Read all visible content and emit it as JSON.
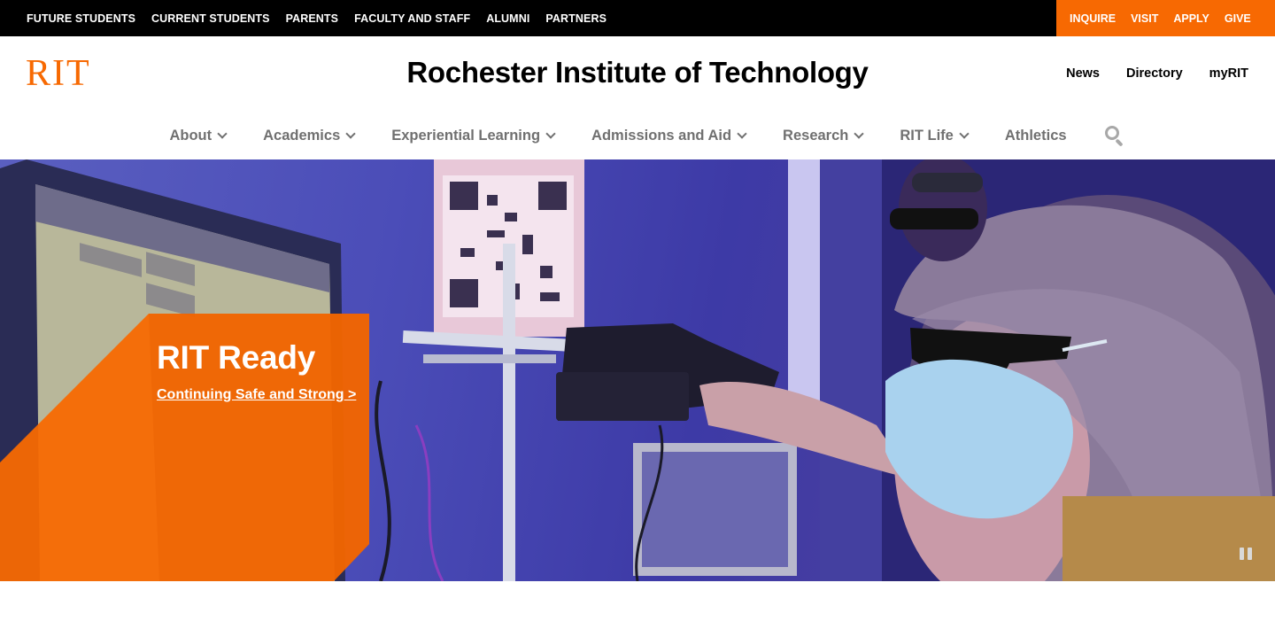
{
  "topbar": {
    "audience_links": [
      "FUTURE STUDENTS",
      "CURRENT STUDENTS",
      "PARENTS",
      "FACULTY AND STAFF",
      "ALUMNI",
      "PARTNERS"
    ],
    "action_links": [
      "INQUIRE",
      "VISIT",
      "APPLY",
      "GIVE"
    ]
  },
  "header": {
    "logo_text": "RIT",
    "title": "Rochester Institute of Technology",
    "utility_links": [
      "News",
      "Directory",
      "myRIT"
    ]
  },
  "nav": {
    "items": [
      {
        "label": "About",
        "has_dropdown": true
      },
      {
        "label": "Academics",
        "has_dropdown": true
      },
      {
        "label": "Experiential Learning",
        "has_dropdown": true
      },
      {
        "label": "Admissions and Aid",
        "has_dropdown": true
      },
      {
        "label": "Research",
        "has_dropdown": true
      },
      {
        "label": "RIT Life",
        "has_dropdown": true
      },
      {
        "label": "Athletics",
        "has_dropdown": false
      }
    ],
    "search_icon": "search-icon"
  },
  "hero": {
    "heading": "RIT Ready",
    "link_label": "Continuing Safe and Strong",
    "link_arrow": ">",
    "pause_icon": "pause-icon"
  },
  "colors": {
    "brand_orange": "#f76902",
    "topbar_bg": "#000000",
    "nav_text": "#707070"
  }
}
